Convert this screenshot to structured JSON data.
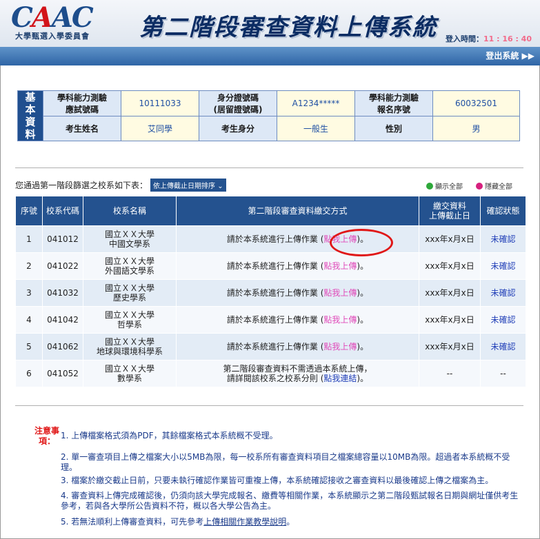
{
  "header": {
    "logo_text": "CAAC",
    "logo_sub": "大學甄選入學委員會",
    "title": "第二階段審查資料上傳系統",
    "login_label": "登入時間：",
    "login_time": "11 : 16 : 40",
    "logout": "登出系統 ▶▶"
  },
  "basic_info": {
    "side_label": "基本資料",
    "exam_id_label": "學科能力測驗應試號碼",
    "exam_id": "10111033",
    "id_label": "身分證號碼(居留證號碼)",
    "id_value": "A1234*****",
    "reg_label": "學科能力測驗報名序號",
    "reg_value": "60032501",
    "name_label": "考生姓名",
    "name_value": "艾同學",
    "status_label": "考生身分",
    "status_value": "一般生",
    "gender_label": "性別",
    "gender_value": "男"
  },
  "list_intro": "您通過第一階段篩選之校系如下表：",
  "sort_button": "依上傳截止日期排序",
  "show_all": "顯示全部",
  "hide_all": "隱藏全部",
  "colors": {
    "show_dot": "#2ea83a",
    "hide_dot": "#d6207e"
  },
  "table": {
    "headers": [
      "序號",
      "校系代碼",
      "校系名稱",
      "第二階段審查資料繳交方式",
      "繳交資料上傳截止日",
      "確認狀態"
    ],
    "rows": [
      {
        "no": "1",
        "code": "041012",
        "name1": "國立ＸＸ大學",
        "name2": "中國文學系",
        "method": "請於本系統進行上傳作業 (",
        "link": "點我上傳",
        "tail": ")。",
        "deadline": "xxx年x月x日",
        "status": "未確認"
      },
      {
        "no": "2",
        "code": "041022",
        "name1": "國立ＸＸ大學",
        "name2": "外國語文學系",
        "method": "請於本系統進行上傳作業 (",
        "link": "點我上傳",
        "tail": ")。",
        "deadline": "xxx年x月x日",
        "status": "未確認"
      },
      {
        "no": "3",
        "code": "041032",
        "name1": "國立ＸＸ大學",
        "name2": "歷史學系",
        "method": "請於本系統進行上傳作業 (",
        "link": "點我上傳",
        "tail": ")。",
        "deadline": "xxx年x月x日",
        "status": "未確認"
      },
      {
        "no": "4",
        "code": "041042",
        "name1": "國立ＸＸ大學",
        "name2": "哲學系",
        "method": "請於本系統進行上傳作業 (",
        "link": "點我上傳",
        "tail": ")。",
        "deadline": "xxx年x月x日",
        "status": "未確認"
      },
      {
        "no": "5",
        "code": "041062",
        "name1": "國立ＸＸ大學",
        "name2": "地球與環境科學系",
        "method": "請於本系統進行上傳作業 (",
        "link": "點我上傳",
        "tail": ")。",
        "deadline": "xxx年x月x日",
        "status": "未確認"
      },
      {
        "no": "6",
        "code": "041052",
        "name1": "國立ＸＸ大學",
        "name2": "數學系",
        "method": "第二階段審查資料不需透過本系統上傳，",
        "method2": "請詳閱該校系之校系分則 (",
        "link": "點我連結",
        "tail": ")。",
        "deadline": "--",
        "status": "--"
      }
    ]
  },
  "notes": {
    "label": "注意事項：",
    "items": [
      "1. 上傳檔案格式須為PDF，其餘檔案格式本系統概不受理。",
      "2. 單一審查項目上傳之檔案大小以5MB為限，每一校系所有審查資料項目之檔案總容量以10MB為限。超過者本系統概不受理。",
      "3. 檔案於繳交截止日前，只要未執行確認作業皆可重複上傳，本系統確認接收之審查資料以最後確認上傳之檔案為主。",
      "4. 審查資料上傳完成確認後，仍須向該大學完成報名、繳費等相關作業，本系統顯示之第二階段甄試報名日期與網址僅供考生參考，若與各大學所公告資料不符，概以各大學公告為主。",
      "5. 若無法順利上傳審查資料，可先參考"
    ],
    "item5_link": "上傳相關作業教學說明",
    "item5_tail": "。"
  }
}
